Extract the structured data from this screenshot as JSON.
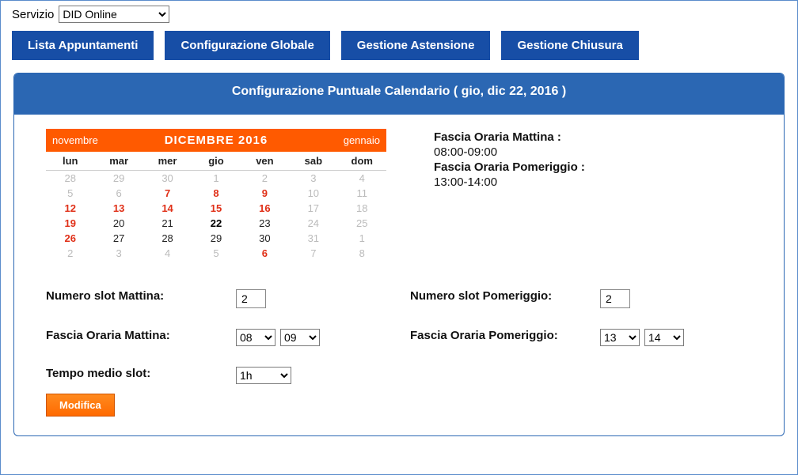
{
  "top": {
    "service_label": "Servizio",
    "service_value": "DID Online"
  },
  "nav": {
    "items": [
      "Lista Appuntamenti",
      "Configurazione Globale",
      "Gestione Astensione",
      "Gestione Chiusura"
    ]
  },
  "panel": {
    "title": "Configurazione Puntuale Calendario ( gio, dic 22, 2016 )"
  },
  "calendar": {
    "prev_label": "novembre",
    "next_label": "gennaio",
    "month_label": "DICEMBRE 2016",
    "dow": [
      "lun",
      "mar",
      "mer",
      "gio",
      "ven",
      "sab",
      "dom"
    ],
    "weeks": [
      [
        {
          "n": "28",
          "c": "d-muted"
        },
        {
          "n": "29",
          "c": "d-muted"
        },
        {
          "n": "30",
          "c": "d-muted"
        },
        {
          "n": "1",
          "c": "d-muted"
        },
        {
          "n": "2",
          "c": "d-muted"
        },
        {
          "n": "3",
          "c": "d-muted"
        },
        {
          "n": "4",
          "c": "d-muted"
        }
      ],
      [
        {
          "n": "5",
          "c": "d-muted"
        },
        {
          "n": "6",
          "c": "d-muted"
        },
        {
          "n": "7",
          "c": "d-red"
        },
        {
          "n": "8",
          "c": "d-red"
        },
        {
          "n": "9",
          "c": "d-red"
        },
        {
          "n": "10",
          "c": "d-muted"
        },
        {
          "n": "11",
          "c": "d-muted"
        }
      ],
      [
        {
          "n": "12",
          "c": "d-red"
        },
        {
          "n": "13",
          "c": "d-red"
        },
        {
          "n": "14",
          "c": "d-red"
        },
        {
          "n": "15",
          "c": "d-red"
        },
        {
          "n": "16",
          "c": "d-red"
        },
        {
          "n": "17",
          "c": "d-muted"
        },
        {
          "n": "18",
          "c": "d-muted"
        }
      ],
      [
        {
          "n": "19",
          "c": "d-red"
        },
        {
          "n": "20",
          "c": "d-norm"
        },
        {
          "n": "21",
          "c": "d-norm"
        },
        {
          "n": "22",
          "c": "d-today"
        },
        {
          "n": "23",
          "c": "d-norm"
        },
        {
          "n": "24",
          "c": "d-muted"
        },
        {
          "n": "25",
          "c": "d-muted"
        }
      ],
      [
        {
          "n": "26",
          "c": "d-red"
        },
        {
          "n": "27",
          "c": "d-norm"
        },
        {
          "n": "28",
          "c": "d-norm"
        },
        {
          "n": "29",
          "c": "d-norm"
        },
        {
          "n": "30",
          "c": "d-norm"
        },
        {
          "n": "31",
          "c": "d-muted"
        },
        {
          "n": "1",
          "c": "d-muted"
        }
      ],
      [
        {
          "n": "2",
          "c": "d-muted"
        },
        {
          "n": "3",
          "c": "d-muted"
        },
        {
          "n": "4",
          "c": "d-muted"
        },
        {
          "n": "5",
          "c": "d-muted"
        },
        {
          "n": "6",
          "c": "d-red"
        },
        {
          "n": "7",
          "c": "d-muted"
        },
        {
          "n": "8",
          "c": "d-muted"
        }
      ]
    ]
  },
  "info": {
    "morning_label": "Fascia Oraria Mattina :",
    "morning_value": "08:00-09:00",
    "afternoon_label": "Fascia Oraria Pomeriggio :",
    "afternoon_value": "13:00-14:00"
  },
  "form": {
    "slot_morning_label": "Numero slot Mattina:",
    "slot_morning_value": "2",
    "slot_afternoon_label": "Numero slot Pomeriggio:",
    "slot_afternoon_value": "2",
    "range_morning_label": "Fascia Oraria Mattina:",
    "range_morning_from": "08",
    "range_morning_to": "09",
    "range_afternoon_label": "Fascia Oraria Pomeriggio:",
    "range_afternoon_from": "13",
    "range_afternoon_to": "14",
    "avg_slot_label": "Tempo medio slot:",
    "avg_slot_value": "1h",
    "modify_label": "Modifica"
  }
}
